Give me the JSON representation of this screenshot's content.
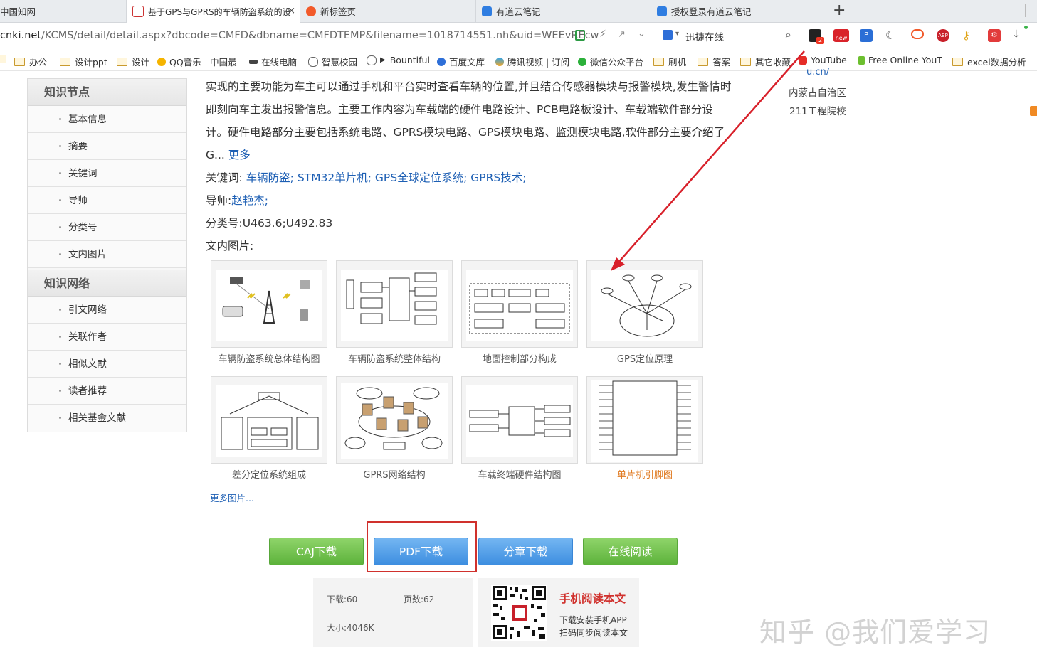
{
  "tabs": [
    {
      "title": "中国知网"
    },
    {
      "title": "基于GPS与GPRS的车辆防盗系统的设",
      "close": "×"
    },
    {
      "title": "新标签页"
    },
    {
      "title": "有道云笔记"
    },
    {
      "title": "授权登录有道云笔记"
    }
  ],
  "new_tab_label": "+",
  "address": {
    "url_host": "cnki.net",
    "url_path": "/KCMS/detail/detail.aspx?dbcode=CMFD&dbname=CMFDTEMP&filename=1018714551.nh&uid=WEEvREcw",
    "download_tool": "迅捷在线",
    "badge_count": "2",
    "new_badge": "new"
  },
  "bookmarks": [
    "办公",
    "设计ppt",
    "设计",
    "QQ音乐 - 中国最",
    "在线电脑",
    "智慧校园",
    "Bountiful",
    "百度文库",
    "腾讯视频 | 订阅",
    "微信公众平台",
    "刷机",
    "答案",
    "其它收藏",
    "YouTube",
    "Free Online YouT",
    "excel数据分析"
  ],
  "bookmark_sep": "▶",
  "right_info": {
    "url_tail": "u.cn/",
    "region": "内蒙古自治区",
    "tag": "211工程院校"
  },
  "sidebar": {
    "section1": "知识节点",
    "items1": [
      "基本信息",
      "摘要",
      "关键词",
      "导师",
      "分类号",
      "文内图片"
    ],
    "section2": "知识网络",
    "items2": [
      "引文网络",
      "关联作者",
      "相似文献",
      "读者推荐",
      "相关基金文献"
    ]
  },
  "abstract": {
    "line1": "实现的主要功能为车主可以通过手机和平台实时查看车辆的位置,并且结合传感器模块与报警模块,发生警情时",
    "line2": "即刻向车主发出报警信息。主要工作内容为车载端的硬件电路设计、PCB电路板设计、车载端软件部分设",
    "line3": "计。硬件电路部分主要包括系统电路、GPRS模块电路、GPS模块电路、监测模块电路,软件部分主要介绍了",
    "line4": "G...",
    "more": "更多"
  },
  "keywords": {
    "label": "关键词:",
    "items": [
      "车辆防盗;",
      "STM32单片机;",
      "GPS全球定位系统;",
      "GPRS技术;"
    ]
  },
  "advisor": {
    "label": "导师:",
    "name": "赵艳杰;"
  },
  "classification": {
    "label": "分类号:",
    "value": "U463.6;U492.83"
  },
  "figures_label": "文内图片:",
  "figures": [
    "车辆防盗系统总体结构图",
    "车辆防盗系统整体结构",
    "地面控制部分构成",
    "GPS定位原理",
    "差分定位系统组成",
    "GPRS网络结构",
    "车载终端硬件结构图",
    "单片机引脚图"
  ],
  "more_figures": "更多图片...",
  "buttons": {
    "caj": "CAJ下载",
    "pdf": "PDF下载",
    "share": "分章下载",
    "online": "在线阅读"
  },
  "stats": {
    "downloads": "下载:60",
    "pages": "页数:62",
    "size": "大小:4046K"
  },
  "mobile": {
    "title": "手机阅读本文",
    "line1": "下载安装手机APP",
    "line2": "扫码同步阅读本文"
  },
  "watermark": "知乎 @我们爱学习",
  "colors": {
    "link": "#1d5fb4",
    "highlight_box": "#d0312d",
    "arrow": "#d8202a",
    "green_btn": "#5cb23a",
    "blue_btn": "#3d8ee0",
    "orange_caption": "#e07a20"
  }
}
